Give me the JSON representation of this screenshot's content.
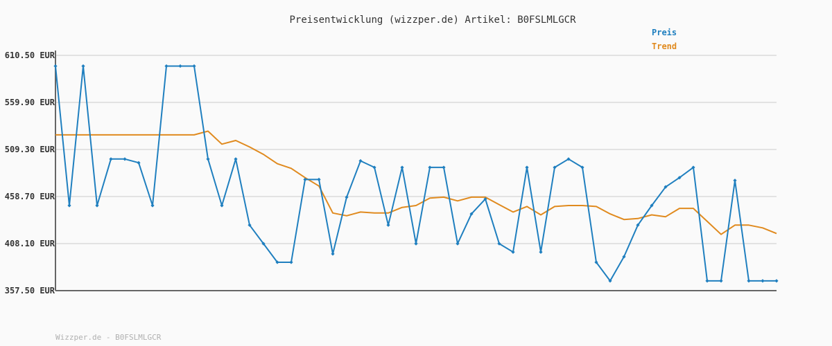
{
  "footer": "Wizzper.de - B0FSLMLGCR",
  "chart_data": {
    "type": "line",
    "title": "Preisentwicklung (wizzper.de) Artikel: B0FSLMLGCR",
    "unit": "EUR",
    "yticks": [
      "610.50 EUR",
      "559.90 EUR",
      "509.30 EUR",
      "458.70 EUR",
      "408.10 EUR",
      "357.50 EUR"
    ],
    "ylim": [
      357.5,
      610.5
    ],
    "grid": true,
    "legend_position": "top-right",
    "colors": {
      "Preis": "#1f7fbf",
      "Trend": "#e08a1e"
    },
    "series": [
      {
        "name": "Preis",
        "color": "#1f7fbf",
        "markers": true,
        "values": [
          599.0,
          449.0,
          599.0,
          449.0,
          499.0,
          499.0,
          495.0,
          449.0,
          599.0,
          599.0,
          599.0,
          499.0,
          449.0,
          499.0,
          428.0,
          408.0,
          388.0,
          388.0,
          477.0,
          477.0,
          397.0,
          458.0,
          497.0,
          490.0,
          428.0,
          490.0,
          408.0,
          490.0,
          490.0,
          408.0,
          440.0,
          456.0,
          408.0,
          399.0,
          490.0,
          399.0,
          490.0,
          499.0,
          490.0,
          388.0,
          368.0,
          394.0,
          428.0,
          449.0,
          469.0,
          479.0,
          490.0,
          368.0,
          368.0,
          476.0,
          368.0,
          368.0,
          368.0
        ]
      },
      {
        "name": "Trend",
        "color": "#e08a1e",
        "markers": false,
        "values": [
          525.0,
          525.0,
          525.0,
          525.0,
          525.0,
          525.0,
          525.0,
          525.0,
          525.0,
          525.0,
          525.0,
          529.0,
          515.0,
          519.0,
          512.0,
          504.0,
          494.0,
          489.0,
          479.0,
          470.0,
          441.0,
          438.0,
          442.0,
          441.0,
          441.0,
          447.0,
          449.0,
          457.0,
          458.0,
          454.0,
          458.0,
          458.0,
          450.0,
          442.0,
          448.0,
          439.0,
          448.0,
          449.0,
          449.0,
          448.0,
          440.0,
          434.0,
          435.0,
          439.0,
          437.0,
          446.0,
          446.0,
          432.0,
          418.0,
          428.0,
          428.0,
          425.0,
          419.0
        ]
      }
    ]
  }
}
